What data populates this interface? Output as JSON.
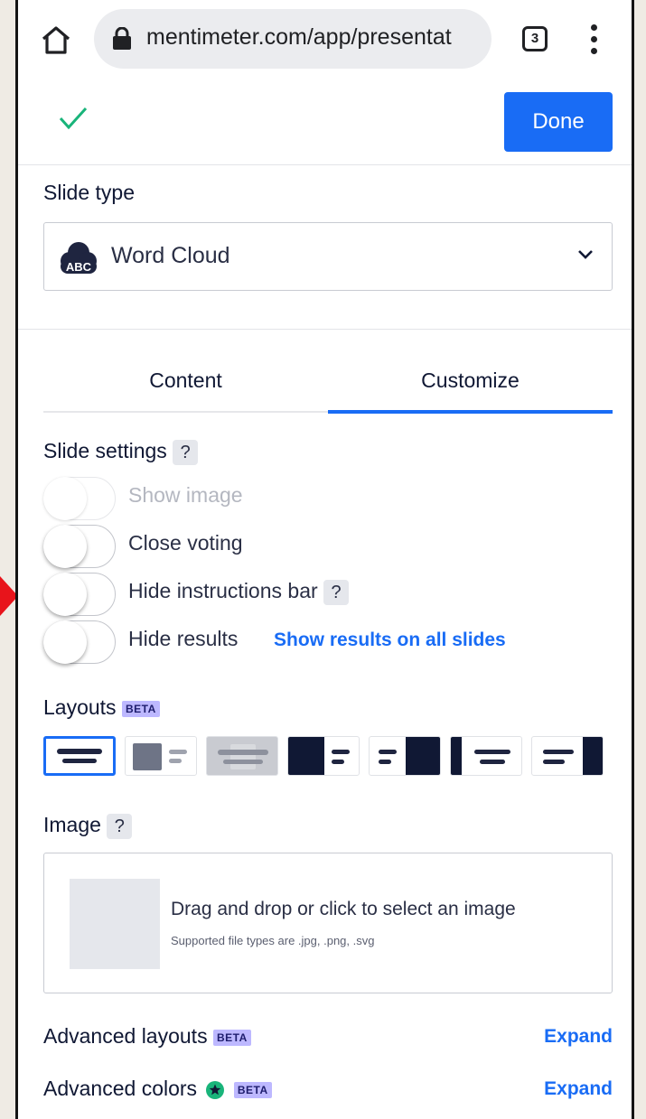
{
  "browser": {
    "url": "mentimeter.com/app/presentat",
    "tab_count": "3"
  },
  "header": {
    "done_label": "Done"
  },
  "slide_type": {
    "label": "Slide type",
    "selected": "Word Cloud",
    "icon_text": "ABC"
  },
  "tabs": [
    {
      "label": "Content",
      "active": false
    },
    {
      "label": "Customize",
      "active": true
    }
  ],
  "slide_settings": {
    "title": "Slide settings",
    "help": "?",
    "toggles": [
      {
        "label": "Show image",
        "enabled": false,
        "disabled": true
      },
      {
        "label": "Close voting",
        "enabled": false,
        "disabled": false
      },
      {
        "label": "Hide instructions bar",
        "enabled": false,
        "disabled": false,
        "help": "?"
      },
      {
        "label": "Hide results",
        "enabled": false,
        "disabled": false,
        "link": "Show results on all slides"
      }
    ]
  },
  "layouts": {
    "title": "Layouts",
    "badge": "BETA",
    "selected_index": 0
  },
  "image": {
    "title": "Image",
    "help": "?",
    "drop_text": "Drag and drop or click to select an image",
    "supported": "Supported file types are .jpg, .png, .svg"
  },
  "advanced": [
    {
      "label": "Advanced layouts",
      "badge": "BETA",
      "action": "Expand"
    },
    {
      "label": "Advanced colors",
      "badge": "BETA",
      "action": "Expand"
    }
  ],
  "colors": {
    "accent": "#196cf5",
    "check": "#19b47a",
    "arrow": "#e8141b"
  }
}
